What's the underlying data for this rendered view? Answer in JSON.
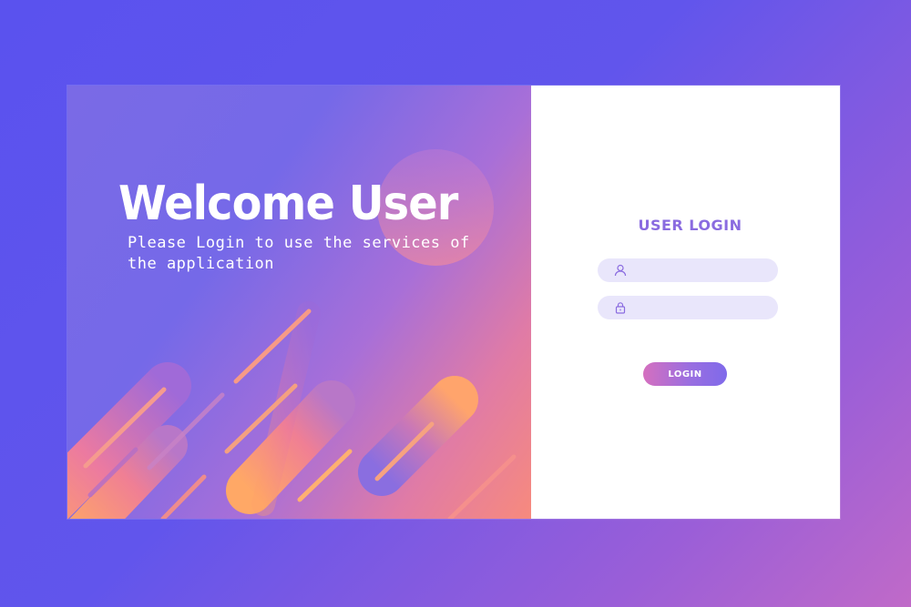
{
  "hero": {
    "title": "Welcome User",
    "subtitle": "Please Login to use the services of the application"
  },
  "login": {
    "title": "USER LOGIN",
    "username": {
      "icon": "user-icon",
      "value": "",
      "placeholder": ""
    },
    "password": {
      "icon": "lock-icon",
      "value": "",
      "placeholder": ""
    },
    "button_label": "LOGIN"
  },
  "colors": {
    "background": "#5a52ee",
    "accent": "#8a6be0",
    "field_bg": "#e9e6fb",
    "button_start": "#d56fbf",
    "button_end": "#7f6aea"
  }
}
